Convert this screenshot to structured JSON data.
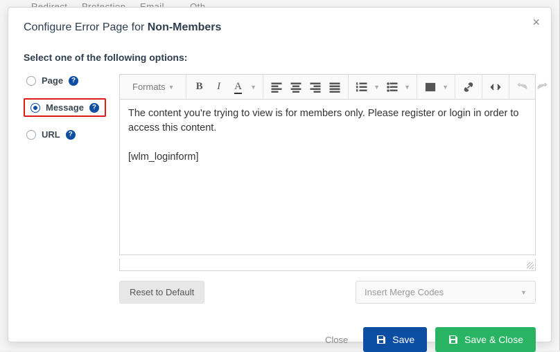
{
  "modal": {
    "title_prefix": "Configure Error Page for ",
    "title_bold": "Non-Members",
    "section_heading": "Select one of the following options:"
  },
  "options": {
    "page": "Page",
    "message": "Message",
    "url": "URL",
    "selected": "message"
  },
  "toolbar": {
    "formats": "Formats"
  },
  "editor": {
    "content": "The content you're trying to view is for members only. Please register or login in order to access this content.\n\n[wlm_loginform]"
  },
  "controls": {
    "reset": "Reset to Default",
    "merge_placeholder": "Insert Merge Codes"
  },
  "footer": {
    "close": "Close",
    "save": "Save",
    "save_close": "Save & Close"
  }
}
